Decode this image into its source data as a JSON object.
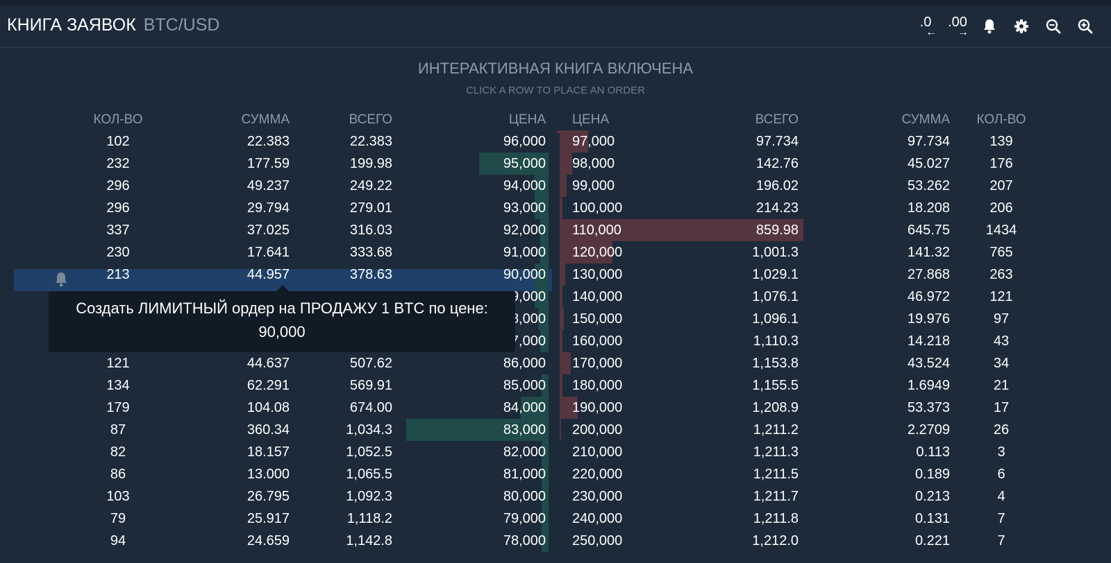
{
  "header": {
    "title": "КНИГА ЗАЯВОК",
    "pair": "BTC/USD",
    "toolbar": {
      "decrease_precision": ".0",
      "increase_precision": ".00",
      "icons": [
        "arrow-left-icon",
        "arrow-right-icon",
        "bell-icon",
        "gear-icon",
        "zoom-out-icon",
        "zoom-in-icon"
      ]
    }
  },
  "banner": {
    "title": "ИНТЕРАКТИВНАЯ КНИГА ВКЛЮЧЕНА",
    "subtitle": "CLICK A ROW TO PLACE AN ORDER"
  },
  "columns": {
    "bids": [
      "КОЛ-ВО",
      "СУММА",
      "ВСЕГО",
      "ЦЕНА"
    ],
    "asks": [
      "ЦЕНА",
      "ВСЕГО",
      "СУММА",
      "КОЛ-ВО"
    ]
  },
  "bids": [
    {
      "count": "102",
      "amount": "22.383",
      "total": "22.383",
      "price": "96,000"
    },
    {
      "count": "232",
      "amount": "177.59",
      "total": "199.98",
      "price": "95,000"
    },
    {
      "count": "296",
      "amount": "49.237",
      "total": "249.22",
      "price": "94,000"
    },
    {
      "count": "296",
      "amount": "29.794",
      "total": "279.01",
      "price": "93,000"
    },
    {
      "count": "337",
      "amount": "37.025",
      "total": "316.03",
      "price": "92,000"
    },
    {
      "count": "230",
      "amount": "17.641",
      "total": "333.68",
      "price": "91,000"
    },
    {
      "count": "213",
      "amount": "44.957",
      "total": "378.63",
      "price": "90,000"
    },
    {
      "count": "",
      "amount": "",
      "total": "",
      "price": "9,000"
    },
    {
      "count": "",
      "amount": "",
      "total": "",
      "price": "8,000"
    },
    {
      "count": "",
      "amount": "",
      "total": "",
      "price": "7,000"
    },
    {
      "count": "121",
      "amount": "44.637",
      "total": "507.62",
      "price": "86,000"
    },
    {
      "count": "134",
      "amount": "62.291",
      "total": "569.91",
      "price": "85,000"
    },
    {
      "count": "179",
      "amount": "104.08",
      "total": "674.00",
      "price": "84,000"
    },
    {
      "count": "87",
      "amount": "360.34",
      "total": "1,034.3",
      "price": "83,000"
    },
    {
      "count": "82",
      "amount": "18.157",
      "total": "1,052.5",
      "price": "82,000"
    },
    {
      "count": "86",
      "amount": "13.000",
      "total": "1,065.5",
      "price": "81,000"
    },
    {
      "count": "103",
      "amount": "26.795",
      "total": "1,092.3",
      "price": "80,000"
    },
    {
      "count": "79",
      "amount": "25.917",
      "total": "1,118.2",
      "price": "79,000"
    },
    {
      "count": "94",
      "amount": "24.659",
      "total": "1,142.8",
      "price": "78,000"
    }
  ],
  "asks": [
    {
      "price": "97,000",
      "total": "97.734",
      "amount": "97.734",
      "count": "139"
    },
    {
      "price": "98,000",
      "total": "142.76",
      "amount": "45.027",
      "count": "176"
    },
    {
      "price": "99,000",
      "total": "196.02",
      "amount": "53.262",
      "count": "207"
    },
    {
      "price": "100,000",
      "total": "214.23",
      "amount": "18.208",
      "count": "206"
    },
    {
      "price": "110,000",
      "total": "859.98",
      "amount": "645.75",
      "count": "1434"
    },
    {
      "price": "120,000",
      "total": "1,001.3",
      "amount": "141.32",
      "count": "765"
    },
    {
      "price": "130,000",
      "total": "1,029.1",
      "amount": "27.868",
      "count": "263"
    },
    {
      "price": "140,000",
      "total": "1,076.1",
      "amount": "46.972",
      "count": "121"
    },
    {
      "price": "150,000",
      "total": "1,096.1",
      "amount": "19.976",
      "count": "97"
    },
    {
      "price": "160,000",
      "total": "1,110.3",
      "amount": "14.218",
      "count": "43"
    },
    {
      "price": "170,000",
      "total": "1,153.8",
      "amount": "43.524",
      "count": "34"
    },
    {
      "price": "180,000",
      "total": "1,155.5",
      "amount": "1.6949",
      "count": "21"
    },
    {
      "price": "190,000",
      "total": "1,208.9",
      "amount": "53.373",
      "count": "17"
    },
    {
      "price": "200,000",
      "total": "1,211.2",
      "amount": "2.2709",
      "count": "26"
    },
    {
      "price": "210,000",
      "total": "1,211.3",
      "amount": "0.113",
      "count": "3"
    },
    {
      "price": "220,000",
      "total": "1,211.5",
      "amount": "0.189",
      "count": "6"
    },
    {
      "price": "230,000",
      "total": "1,211.7",
      "amount": "0.213",
      "count": "4"
    },
    {
      "price": "240,000",
      "total": "1,211.8",
      "amount": "0.131",
      "count": "7"
    },
    {
      "price": "250,000",
      "total": "1,212.0",
      "amount": "0.221",
      "count": "7"
    }
  ],
  "highlighted_row": 6,
  "tooltip": {
    "line1": "Создать ЛИМИТНЫЙ ордер на ПРОДАЖУ 1 BTC по цене:",
    "line2": "90,000"
  },
  "colors": {
    "background": "#1c2a3a",
    "bid_bar": "#1f4b4a",
    "ask_bar": "#553540",
    "highlight": "#1f4068",
    "muted_text": "#8e9aa7"
  }
}
